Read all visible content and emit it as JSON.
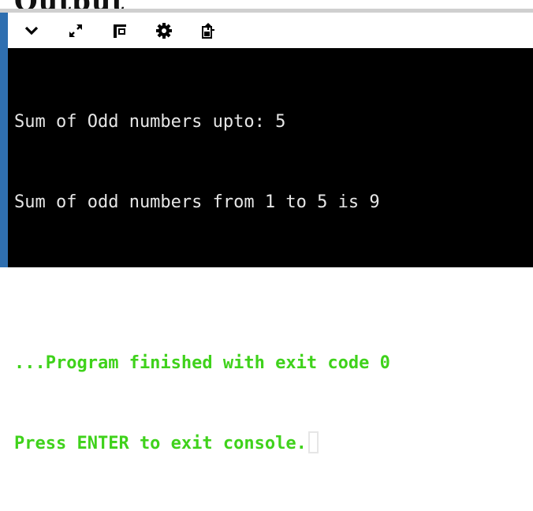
{
  "page": {
    "heading_fragment": "Output"
  },
  "toolbar": {
    "buttons": [
      {
        "icon": "chevron-down-icon"
      },
      {
        "icon": "expand-icon"
      },
      {
        "icon": "layout-icon"
      },
      {
        "icon": "gear-icon"
      },
      {
        "icon": "export-icon"
      }
    ]
  },
  "console": {
    "line1": "Sum of Odd numbers upto: 5",
    "line2": "Sum of odd numbers from 1 to 5 is 9",
    "line3": "",
    "line4": "...Program finished with exit code 0",
    "line5": "Press ENTER to exit console."
  },
  "colors": {
    "console_bg": "#000000",
    "output_text": "#e6e6e6",
    "status_text": "#3fd21b",
    "accent": "#2f6fb0"
  }
}
